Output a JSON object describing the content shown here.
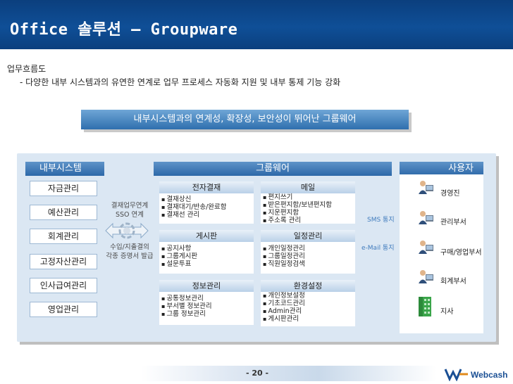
{
  "slide": {
    "title": "Office 솔루션 – Groupware",
    "heading": "업무흐름도",
    "description": "- 다양한 내부 시스템과의 유연한 연계로 업무 프로세스 자동화 지원 및 내부 통제 기능 강화",
    "banner": "내부시스템과의 연계성, 확장성, 보안성이 뛰어난 그룹웨어",
    "page_number": "- 20 -",
    "logo_text": "Webcash"
  },
  "internal": {
    "header": "내부시스템",
    "items": [
      "자금관리",
      "예산관리",
      "회계관리",
      "고정자산관리",
      "인사급여관리",
      "영업관리"
    ]
  },
  "flow_labels": {
    "top_line1": "결재업무연계",
    "top_line2": "SSO 연계",
    "bottom_line1": "수입/지출결의",
    "bottom_line2": "각종 증명서 발급"
  },
  "groupware": {
    "header": "그룹웨어",
    "boxes": [
      {
        "title": "전자결재",
        "items": [
          "결재상신",
          "결재대기/반송/완료함",
          "결재선 관리"
        ]
      },
      {
        "title": "메일",
        "items": [
          "편지쓰기",
          "받은편지함/보낸편지함",
          "지운편지함",
          "주소록 관리"
        ]
      },
      {
        "title": "게시판",
        "items": [
          "공지사항",
          "그룹게시판",
          "설문투표"
        ]
      },
      {
        "title": "일정관리",
        "items": [
          "개인일정관리",
          "그룹일정관리",
          "직원일정검색"
        ]
      },
      {
        "title": "정보관리",
        "items": [
          "공통정보관리",
          "부서별 정보관리",
          "그룹 정보관리"
        ]
      },
      {
        "title": "환경설정",
        "items": [
          "개인정보설정",
          "기초코드관리",
          "Admin관리",
          "게시판관리"
        ]
      }
    ]
  },
  "connections": {
    "sms": "SMS 통지",
    "email": "e-Mail 통지"
  },
  "users": {
    "header": "사용자",
    "items": [
      "경영진",
      "관리부서",
      "구매/영업부서",
      "회계부서",
      "지사"
    ]
  },
  "colors": {
    "title_bar": "#0f4f97",
    "panel_bg": "#dbe7f3",
    "header_blue": "#2d68a8",
    "accent_text": "#3f7bbd"
  }
}
